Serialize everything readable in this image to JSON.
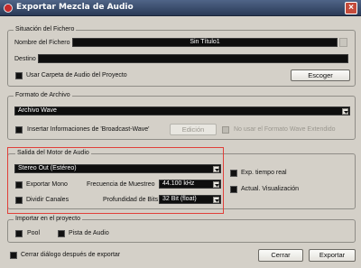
{
  "window": {
    "title": "Exportar Mezcla de Audio",
    "close_label": "×"
  },
  "situacion": {
    "legend": "Situación del Fichero",
    "nombre_label": "Nombre del Fichero",
    "nombre_value": "Sin Título1",
    "destino_label": "Destino",
    "destino_value": "",
    "usar_carpeta_label": "Usar Carpeta de Audio del Proyecto",
    "escoger_label": "Escoger"
  },
  "formato": {
    "legend": "Formato de Archivo",
    "tipo_value": "Archivo Wave",
    "broadcast_label": "Insertar Informaciones de 'Broadcast-Wave'",
    "edicion_label": "Edición",
    "no_usar_label": "No usar el Formato Wave Extendido"
  },
  "salida": {
    "legend": "Salida del Motor de Audio",
    "output_value": "Stereo Out (Estéreo)",
    "exportar_mono_label": "Exportar Mono",
    "dividir_canales_label": "Dividir Canales",
    "frecuencia_label": "Frecuencia de Muestreo",
    "frecuencia_value": "44.100 kHz",
    "profundidad_label": "Profundidad de Bits",
    "profundidad_value": "32 Bit (float)",
    "exp_tiempo_real_label": "Exp. tiempo real",
    "actual_visualizacion_label": "Actual. Visualización"
  },
  "importar": {
    "legend": "Importar en el proyecto",
    "pool_label": "Pool",
    "pista_label": "Pista de Audio"
  },
  "footer": {
    "cerrar_dialogo_label": "Cerrar diálogo después de exportar",
    "cerrar_label": "Cerrar",
    "exportar_label": "Exportar"
  },
  "colors": {
    "highlight": "#e0403a",
    "title_bar": "#2f405f",
    "dark_field": "#0e0e0e"
  }
}
